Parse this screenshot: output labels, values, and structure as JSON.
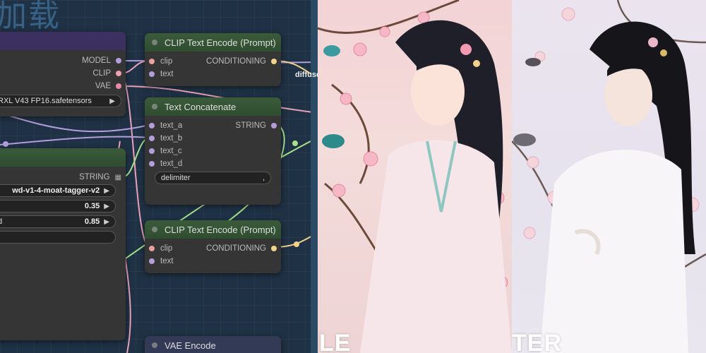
{
  "canvas": {
    "background_title": "加载",
    "nodes": {
      "checkpoint_loader": {
        "outputs": [
          "MODEL",
          "CLIP",
          "VAE"
        ],
        "ckpt_value": "RXL V43 FP16.safetensors"
      },
      "tagger": {
        "output": "STRING",
        "model_value": "wd-v1-4-moat-tagger-v2",
        "threshold_value": "0.35",
        "char_threshold_label": "d",
        "char_threshold_value": "0.85"
      },
      "clip_encode_1": {
        "title": "CLIP Text Encode (Prompt)",
        "inputs": [
          "clip",
          "text"
        ],
        "output": "CONDITIONING"
      },
      "text_concat": {
        "title": "Text Concatenate",
        "inputs": [
          "text_a",
          "text_b",
          "text_c",
          "text_d"
        ],
        "output": "STRING",
        "delimiter_label": "delimiter",
        "delimiter_value": ","
      },
      "clip_encode_2": {
        "title": "CLIP Text Encode (Prompt)",
        "inputs": [
          "clip",
          "text"
        ],
        "output": "CONDITIONING"
      },
      "vae_encode": {
        "title": "VAE Encode"
      }
    },
    "offscreen_label": "diffuse"
  },
  "images": {
    "anime_caption": "LE",
    "real_caption": "TER"
  },
  "colors": {
    "model_wire": "#b39ddb",
    "clip_wire": "#f0c060",
    "string_wire": "#a7e28a",
    "conditioning_wire": "#f2d28a",
    "pink_wire": "#e9a0b8"
  }
}
